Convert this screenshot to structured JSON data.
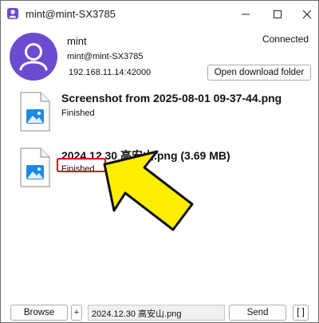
{
  "window": {
    "title": "mint@mint-SX3785"
  },
  "peer": {
    "name": "mint",
    "host": "mint@mint-SX3785",
    "ip": "192.168.11.14:42000",
    "status": "Connected",
    "avatar_color": "#6c4bd1"
  },
  "actions": {
    "open_download_folder": "Open download folder"
  },
  "files": [
    {
      "name": "Screenshot from 2025-08-01 09-37-44.png",
      "status": "Finished",
      "icon": "image-file-icon"
    },
    {
      "name": "2024.12.30 高安山.png (3.69 MB)",
      "status": "Finished",
      "icon": "image-file-icon"
    }
  ],
  "annotation": {
    "highlight_color": "#e0000c",
    "arrow_color": "#ffee00"
  },
  "bottom": {
    "browse_label": "Browse",
    "plus_label": "+",
    "selected_file": "2024.12.30 高安山.png",
    "send_label": "Send",
    "extra_label": "[ ]"
  }
}
